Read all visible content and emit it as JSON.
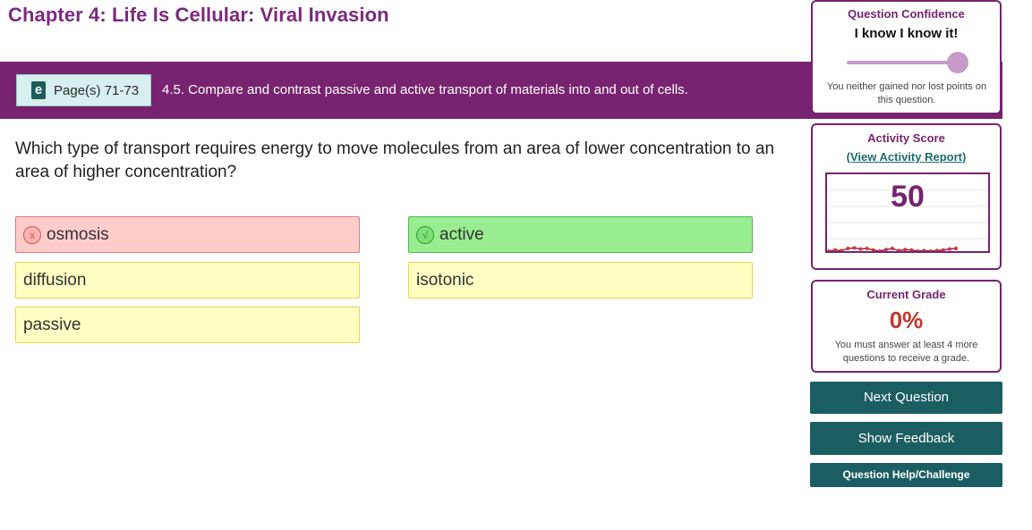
{
  "chapter": {
    "title": "Chapter 4: Life Is Cellular: Viral Invasion"
  },
  "banner": {
    "pages_label": "Page(s) 71-73",
    "book_icon_letter": "e",
    "objective": "4.5. Compare and contrast passive and active transport of materials into and out of cells."
  },
  "question": {
    "text": "Which type of transport requires energy to move molecules from an area of lower concentration to an area of higher concentration?"
  },
  "answers": [
    {
      "label": "osmosis",
      "state": "incorrect",
      "mark": "x"
    },
    {
      "label": "active",
      "state": "correct",
      "mark": "√"
    },
    {
      "label": "diffusion",
      "state": "unselected"
    },
    {
      "label": "isotonic",
      "state": "unselected"
    },
    {
      "label": "passive",
      "state": "unselected"
    }
  ],
  "confidence": {
    "title": "Question Confidence",
    "value": "I know I know it!",
    "slider_level": 1.0,
    "note": "You neither gained nor lost points on this question."
  },
  "activity": {
    "title": "Activity Score",
    "link": "(View Activity Report)",
    "score": "50",
    "sparkline": [
      0,
      0.2,
      0.1,
      0.5,
      0.6,
      0.4,
      0.5,
      0.2,
      0,
      0.3,
      0.5,
      0.1,
      0.3,
      0.2,
      0,
      0.1,
      0,
      0.1,
      0.2,
      0.4,
      0.5
    ]
  },
  "grade": {
    "title": "Current Grade",
    "value": "0%",
    "note": "You must answer at least 4 more questions to receive a grade."
  },
  "buttons": {
    "next": "Next Question",
    "feedback": "Show Feedback",
    "help": "Question Help/Challenge"
  },
  "colors": {
    "brand_purple": "#77236f",
    "button_teal": "#1a5e62",
    "correct_green": "#98ed90",
    "incorrect_red": "#ffcccc",
    "neutral_yellow": "#ffffc4",
    "sparkline_red": "#d9342b"
  }
}
